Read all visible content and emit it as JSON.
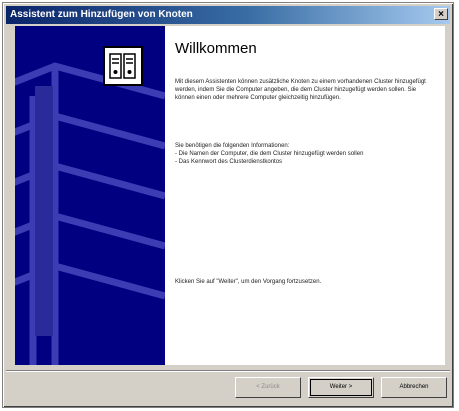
{
  "window": {
    "title": "Assistent zum Hinzufügen von Knoten",
    "close_glyph": "×"
  },
  "main": {
    "heading": "Willkommen",
    "intro": "Mit diesem Assistenten können zusätzliche Knoten zu einem vorhandenen Cluster hinzugefügt werden, indem Sie die Computer angeben, die dem Cluster hinzugefügt werden sollen. Sie können einen oder mehrere Computer gleichzeitig hinzufügen.",
    "info_header": "Sie benötigen die folgenden Informationen:",
    "info_item_1": "- Die Namen der Computer, die dem Cluster hinzugefügt werden sollen",
    "info_item_2": "- Das Kennwort des Clusterdienstkontos",
    "continue_hint": "Klicken Sie auf \"Weiter\", um den Vorgang fortzusetzen."
  },
  "buttons": {
    "back": "< Zurück",
    "next": "Weiter >",
    "cancel": "Abbrechen"
  },
  "colors": {
    "side_panel": "#000080",
    "titlebar_start": "#0a246a",
    "titlebar_end": "#a6caf0"
  },
  "icons": {
    "wizard": "cluster-servers-icon",
    "close": "close-icon"
  }
}
